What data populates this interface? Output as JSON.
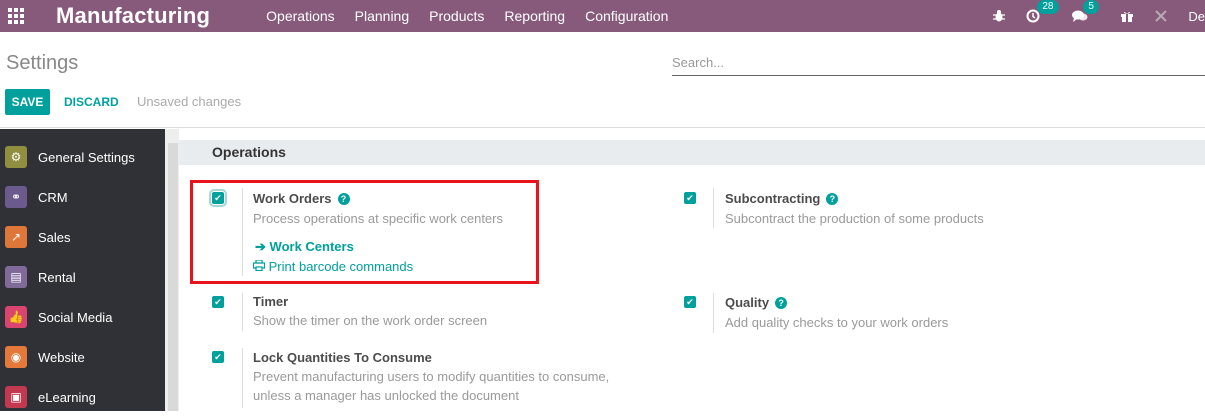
{
  "navbar": {
    "brand": "Manufacturing",
    "menu": [
      "Operations",
      "Planning",
      "Products",
      "Reporting",
      "Configuration"
    ],
    "activity_count": "28",
    "message_count": "5",
    "user_text": "De"
  },
  "control_panel": {
    "title": "Settings",
    "search_placeholder": "Search...",
    "save_label": "SAVE",
    "discard_label": "DISCARD",
    "unsaved_label": "Unsaved changes"
  },
  "sidebar": {
    "items": [
      {
        "label": "General Settings",
        "color": "#8f8f3f"
      },
      {
        "label": "CRM",
        "color": "#6b5a8e"
      },
      {
        "label": "Sales",
        "color": "#e0773a"
      },
      {
        "label": "Rental",
        "color": "#7f6a9a"
      },
      {
        "label": "Social Media",
        "color": "#d9456e"
      },
      {
        "label": "Website",
        "color": "#e5793b"
      },
      {
        "label": "eLearning",
        "color": "#c2384f"
      }
    ]
  },
  "content": {
    "section_title": "Operations",
    "settings": {
      "work_orders": {
        "title": "Work Orders",
        "desc": "Process operations at specific work centers",
        "link1": "Work Centers",
        "link2": "Print barcode commands"
      },
      "subcontracting": {
        "title": "Subcontracting",
        "desc": "Subcontract the production of some products"
      },
      "timer": {
        "title": "Timer",
        "desc": "Show the timer on the work order screen"
      },
      "quality": {
        "title": "Quality",
        "desc": "Add quality checks to your work orders"
      },
      "lock_quantities": {
        "title": "Lock Quantities To Consume",
        "desc1": "Prevent manufacturing users to modify quantities to consume,",
        "desc2": "unless a manager has unlocked the document"
      }
    }
  },
  "colors": {
    "navbar": "#875a7b",
    "accent": "#00a09d",
    "highlight": "#e8141b"
  }
}
